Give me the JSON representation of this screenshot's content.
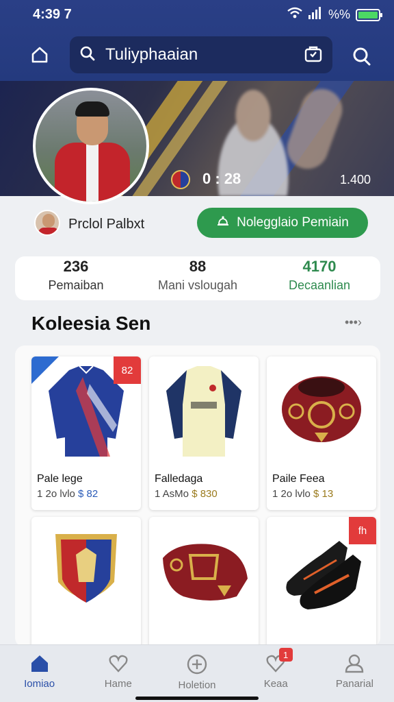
{
  "status_bar": {
    "time": "4:39 7",
    "battery_text": "%%"
  },
  "header": {
    "search_text": "Tuliyphaaian"
  },
  "hero": {
    "score": "0 : 28",
    "views": "1.400"
  },
  "profile": {
    "name": "Prclol Palbxt",
    "follow_label": "Nolegglaio Pemiain"
  },
  "stats": [
    {
      "value": "236",
      "label": "Pemaiban"
    },
    {
      "value": "88",
      "label": "Mani vslougah"
    },
    {
      "value": "4170",
      "label": "Decaanlian"
    }
  ],
  "collection": {
    "title": "Koleesia Sen",
    "more": "•••›",
    "items": [
      {
        "name": "Pale lege",
        "meta": "1 2o lvlo",
        "price": "$ 82",
        "tag": "82"
      },
      {
        "name": "Falledaga",
        "meta": "1 AsMo",
        "price": "$ 830",
        "tag": ""
      },
      {
        "name": "Paile Feea",
        "meta": "1 2o lvlo",
        "price": "$ 13",
        "tag": ""
      },
      {
        "name": "",
        "meta": "",
        "price": "",
        "tag": ""
      },
      {
        "name": "",
        "meta": "",
        "price": "",
        "tag": ""
      },
      {
        "name": "",
        "meta": "",
        "price": "",
        "tag": "fh"
      }
    ]
  },
  "bottom_nav": [
    {
      "label": "Iomiao",
      "icon": "home-icon"
    },
    {
      "label": "Hame",
      "icon": "heart-icon"
    },
    {
      "label": "Holetion",
      "icon": "plus-circle-icon"
    },
    {
      "label": "Keaa",
      "icon": "heart-icon",
      "badge": "1"
    },
    {
      "label": "Panarial",
      "icon": "user-icon"
    }
  ],
  "colors": {
    "header": "#2a3f86",
    "accent_green": "#2e9a4e",
    "active_nav": "#2a4fa8",
    "badge_red": "#e23b3b"
  }
}
